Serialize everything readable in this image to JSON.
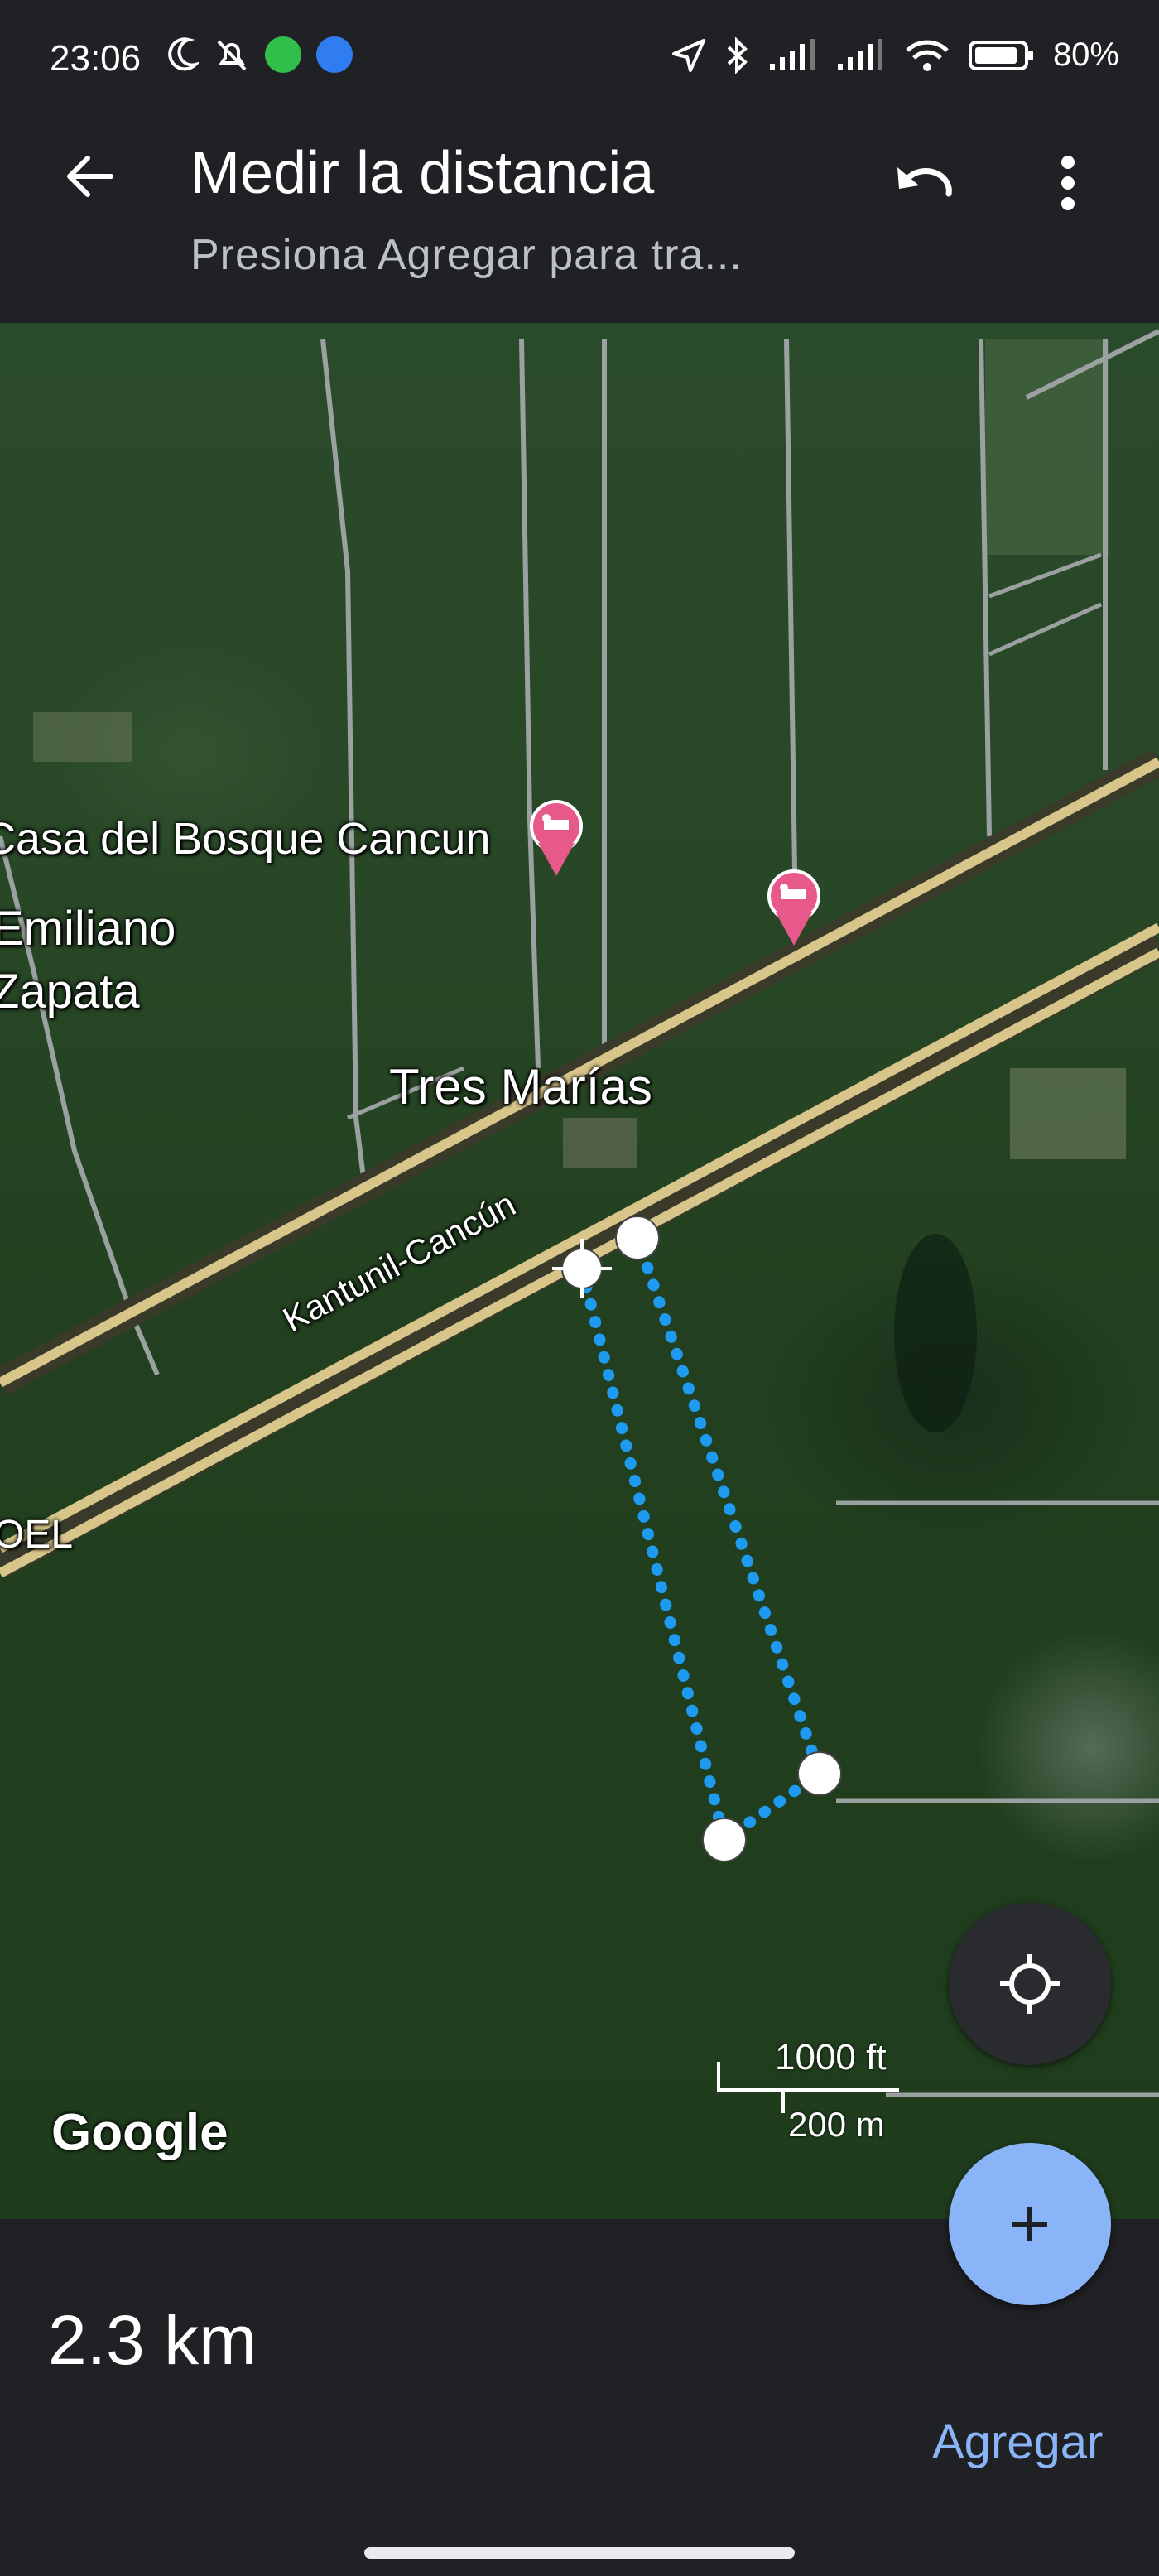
{
  "status_bar": {
    "time": "23:06",
    "battery": "80%"
  },
  "app_bar": {
    "title": "Medir la distancia",
    "subtitle": "Presiona Agregar para tra..."
  },
  "map": {
    "labels": {
      "place_1": "Casa del Bosque Cancun",
      "place_2": "Emiliano",
      "place_3": "Zapata",
      "place_4": "Tres Marías",
      "road": "Kantunil-Cancún",
      "road_2": "OEL"
    },
    "attribution": "Google",
    "scale": {
      "imperial": "1000 ft",
      "metric": "200 m"
    },
    "colors": {
      "measure_line": "#1e9bf0",
      "poi_pin": "#e8598b"
    }
  },
  "measurement": {
    "distance": "2.3 km",
    "add_label": "Agregar"
  }
}
